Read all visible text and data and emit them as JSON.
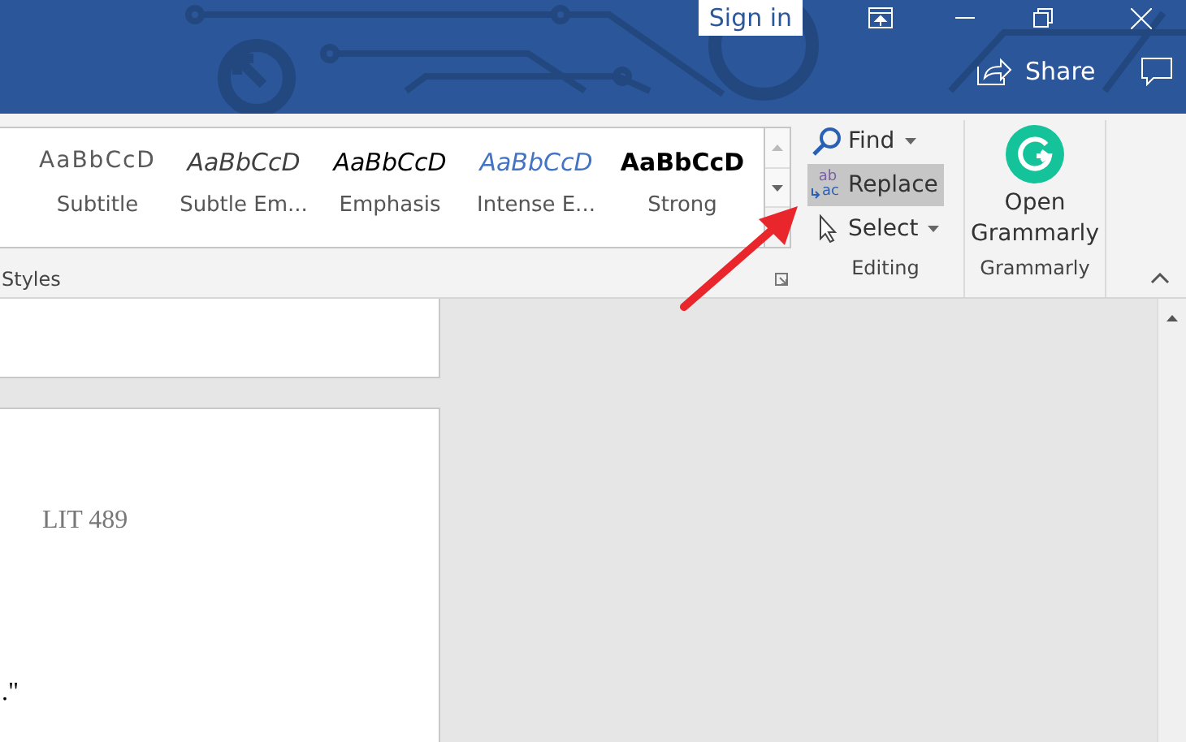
{
  "title_bar": {
    "sign_in": "Sign in",
    "share": "Share"
  },
  "styles_gallery": {
    "items": [
      {
        "preview": "AaBbCcD",
        "name": "Subtitle",
        "kind": "subtitle"
      },
      {
        "preview": "AaBbCcD",
        "name": "Subtle Em...",
        "kind": "subtle_emphasis"
      },
      {
        "preview": "AaBbCcD",
        "name": "Emphasis",
        "kind": "emphasis"
      },
      {
        "preview": "AaBbCcD",
        "name": "Intense E...",
        "kind": "intense_emphasis"
      },
      {
        "preview": "AaBbCcD",
        "name": "Strong",
        "kind": "strong"
      }
    ],
    "group_label": "Styles"
  },
  "editing": {
    "items": [
      {
        "label": "Find",
        "kind": "find",
        "selected": false
      },
      {
        "label": "Replace",
        "kind": "replace",
        "selected": true,
        "icon_top": "ab",
        "icon_bottom": "ac"
      },
      {
        "label": "Select",
        "kind": "select",
        "selected": false
      }
    ],
    "group_label": "Editing"
  },
  "grammarly": {
    "button": "Open Grammarly",
    "group_label": "Grammarly"
  },
  "document": {
    "heading": "LIT 489",
    "text_end": ".\""
  }
}
